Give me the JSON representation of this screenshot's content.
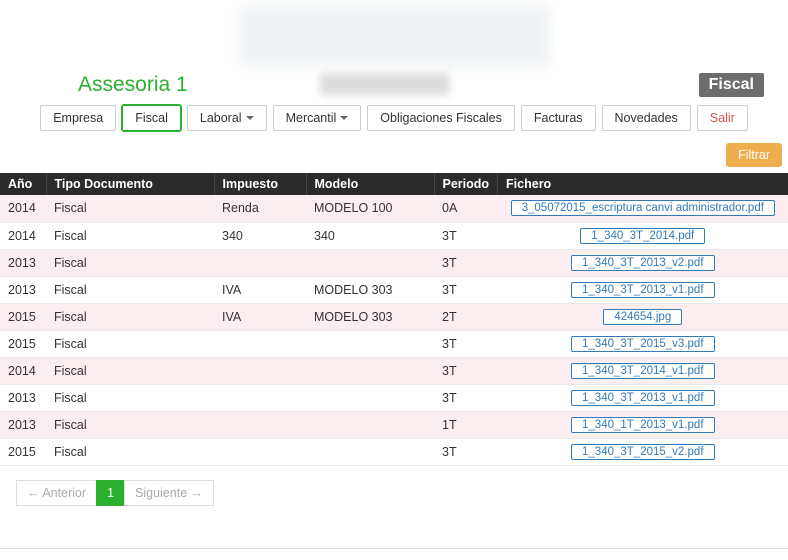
{
  "header": {
    "title": "Assesoria 1",
    "category_badge": "Fiscal"
  },
  "nav": {
    "items": [
      {
        "label": "Empresa",
        "active": false,
        "dd": false,
        "exit": false
      },
      {
        "label": "Fiscal",
        "active": true,
        "dd": false,
        "exit": false
      },
      {
        "label": "Laboral",
        "active": false,
        "dd": true,
        "exit": false
      },
      {
        "label": "Mercantil",
        "active": false,
        "dd": true,
        "exit": false
      },
      {
        "label": "Obligaciones Fiscales",
        "active": false,
        "dd": false,
        "exit": false
      },
      {
        "label": "Facturas",
        "active": false,
        "dd": false,
        "exit": false
      },
      {
        "label": "Novedades",
        "active": false,
        "dd": false,
        "exit": false
      },
      {
        "label": "Salir",
        "active": false,
        "dd": false,
        "exit": true
      }
    ]
  },
  "actions": {
    "filter": "Filtrar"
  },
  "table": {
    "headers": {
      "ano": "Año",
      "tipo": "Tipo Documento",
      "impuesto": "Impuesto",
      "modelo": "Modelo",
      "periodo": "Periodo",
      "fichero": "Fichero"
    },
    "rows": [
      {
        "ano": "2014",
        "tipo": "Fiscal",
        "impuesto": "Renda",
        "modelo": "MODELO 100",
        "periodo": "0A",
        "fichero": "3_05072015_escriptura canvi administrador.pdf"
      },
      {
        "ano": "2014",
        "tipo": "Fiscal",
        "impuesto": "340",
        "modelo": "340",
        "periodo": "3T",
        "fichero": "1_340_3T_2014.pdf"
      },
      {
        "ano": "2013",
        "tipo": "Fiscal",
        "impuesto": "",
        "modelo": "",
        "periodo": "3T",
        "fichero": "1_340_3T_2013_v2.pdf"
      },
      {
        "ano": "2013",
        "tipo": "Fiscal",
        "impuesto": "IVA",
        "modelo": "MODELO 303",
        "periodo": "3T",
        "fichero": "1_340_3T_2013_v1.pdf"
      },
      {
        "ano": "2015",
        "tipo": "Fiscal",
        "impuesto": "IVA",
        "modelo": "MODELO 303",
        "periodo": "2T",
        "fichero": "424654.jpg"
      },
      {
        "ano": "2015",
        "tipo": "Fiscal",
        "impuesto": "",
        "modelo": "",
        "periodo": "3T",
        "fichero": "1_340_3T_2015_v3.pdf"
      },
      {
        "ano": "2014",
        "tipo": "Fiscal",
        "impuesto": "",
        "modelo": "",
        "periodo": "3T",
        "fichero": "1_340_3T_2014_v1.pdf"
      },
      {
        "ano": "2013",
        "tipo": "Fiscal",
        "impuesto": "",
        "modelo": "",
        "periodo": "3T",
        "fichero": "1_340_3T_2013_v1.pdf"
      },
      {
        "ano": "2013",
        "tipo": "Fiscal",
        "impuesto": "",
        "modelo": "",
        "periodo": "1T",
        "fichero": "1_340_1T_2013_v1.pdf"
      },
      {
        "ano": "2015",
        "tipo": "Fiscal",
        "impuesto": "",
        "modelo": "",
        "periodo": "3T",
        "fichero": "1_340_3T_2015_v2.pdf"
      }
    ]
  },
  "pager": {
    "prev": "← Anterior",
    "current": "1",
    "next": "Siguiente →"
  }
}
